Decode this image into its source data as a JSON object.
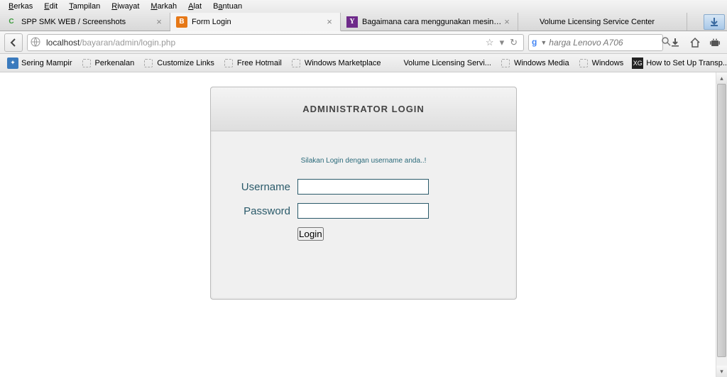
{
  "menu": {
    "items": [
      "Berkas",
      "Edit",
      "Tampilan",
      "Riwayat",
      "Markah",
      "Alat",
      "Bantuan"
    ]
  },
  "tabs": [
    {
      "title": "SPP SMK WEB / Screenshots",
      "favicon": "c",
      "active": false,
      "closable": true
    },
    {
      "title": "Form Login",
      "favicon": "o",
      "active": true,
      "closable": true
    },
    {
      "title": "Bagaimana cara menggunakan mesin cuci...",
      "favicon": "y",
      "active": false,
      "closable": true
    },
    {
      "title": "Volume Licensing Service Center",
      "favicon": "ms",
      "active": false,
      "closable": false
    }
  ],
  "url": {
    "host": "localhost",
    "path": "/bayaran/admin/login.php"
  },
  "search": {
    "value": "harga Lenovo A706"
  },
  "bookmarks": [
    {
      "label": "Sering Mampir",
      "icon": "blue"
    },
    {
      "label": "Perkenalan",
      "icon": "sq"
    },
    {
      "label": "Customize Links",
      "icon": "sq"
    },
    {
      "label": "Free Hotmail",
      "icon": "sq"
    },
    {
      "label": "Windows Marketplace",
      "icon": "sq"
    },
    {
      "label": "Volume Licensing Servi...",
      "icon": "ms"
    },
    {
      "label": "Windows Media",
      "icon": "sq"
    },
    {
      "label": "Windows",
      "icon": "sq"
    },
    {
      "label": "How to Set Up Transp...",
      "icon": "xg"
    }
  ],
  "login": {
    "title": "ADMINISTRATOR LOGIN",
    "hint": "Silakan Login dengan username anda..!",
    "username_label": "Username",
    "password_label": "Password",
    "button": "Login"
  }
}
